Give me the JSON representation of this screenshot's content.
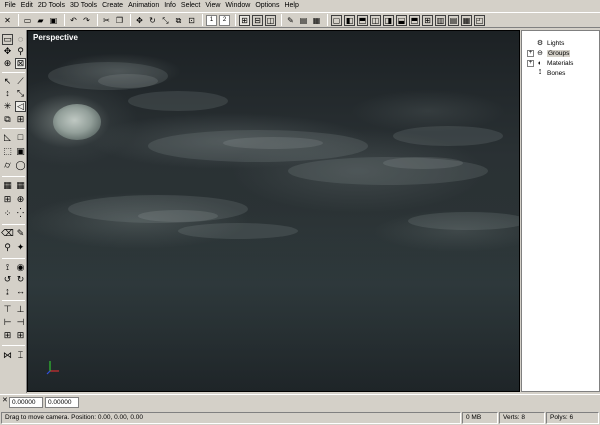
{
  "menu": [
    "File",
    "Edit",
    "2D Tools",
    "3D Tools",
    "Create",
    "Animation",
    "Info",
    "Select",
    "View",
    "Window",
    "Options",
    "Help"
  ],
  "toolbar": {
    "numbers": [
      "1",
      "2"
    ]
  },
  "viewport": {
    "title": "Perspective"
  },
  "tree": {
    "items": [
      {
        "label": "Lights",
        "expandable": false
      },
      {
        "label": "Groups",
        "expandable": true,
        "selected": true
      },
      {
        "label": "Materials",
        "expandable": true
      },
      {
        "label": "Bones",
        "expandable": false
      }
    ]
  },
  "coords": {
    "field1": "0.00000",
    "field2": "0.00000"
  },
  "status": {
    "message": "Drag to move camera. Position: 0.00, 0.00, 0.00",
    "memory": "0 MB",
    "verts": "Verts: 8",
    "polys": "Polys: 6"
  },
  "colors": {
    "chrome": "#d4d0c8",
    "axis_x": "#d03030",
    "axis_y": "#30c030",
    "axis_z": "#3050e0"
  }
}
